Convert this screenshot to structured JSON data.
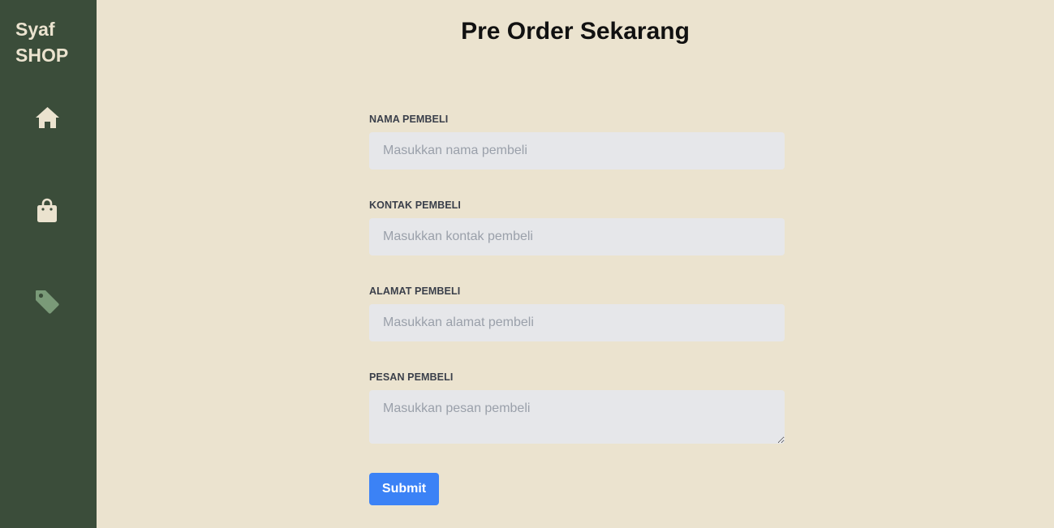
{
  "brand": {
    "line1": "Syaf",
    "line2": "SHOP"
  },
  "sidebar": {
    "items": [
      {
        "icon": "home-icon",
        "color": "#ebe3cf"
      },
      {
        "icon": "shopping-bag-icon",
        "color": "#ebe3cf"
      },
      {
        "icon": "tag-icon",
        "color": "#7a9a78",
        "active": true
      }
    ]
  },
  "page": {
    "title": "Pre Order Sekarang"
  },
  "form": {
    "name": {
      "label": "NAMA PEMBELI",
      "placeholder": "Masukkan nama pembeli",
      "value": ""
    },
    "contact": {
      "label": "KONTAK PEMBELI",
      "placeholder": "Masukkan kontak pembeli",
      "value": ""
    },
    "address": {
      "label": "ALAMAT PEMBELI",
      "placeholder": "Masukkan alamat pembeli",
      "value": ""
    },
    "message": {
      "label": "PESAN PEMBELI",
      "placeholder": "Masukkan pesan pembeli",
      "value": ""
    },
    "submit_label": "Submit"
  },
  "colors": {
    "background": "#ebe3cf",
    "sidebar": "#3b4d3a",
    "accent": "#3b82f6",
    "input_bg": "#e6e7ea"
  }
}
